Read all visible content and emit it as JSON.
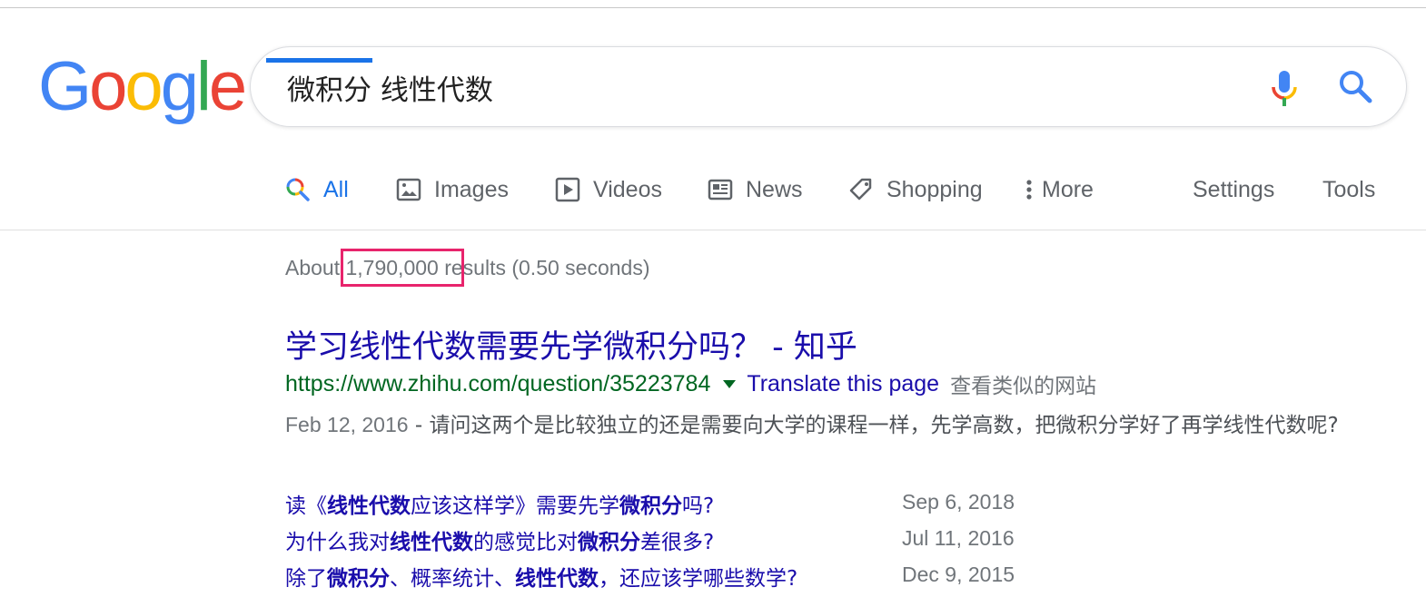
{
  "logo": {
    "letters": [
      "G",
      "o",
      "o",
      "g",
      "l",
      "e"
    ],
    "colors": [
      "#4285F4",
      "#EA4335",
      "#FBBC05",
      "#4285F4",
      "#34A853",
      "#EA4335"
    ]
  },
  "search": {
    "query": "微积分 线性代数"
  },
  "tabs": [
    {
      "label": "All",
      "icon": "search-multicolor-icon",
      "active": true
    },
    {
      "label": "Images",
      "icon": "image-icon"
    },
    {
      "label": "Videos",
      "icon": "play-icon"
    },
    {
      "label": "News",
      "icon": "newspaper-icon"
    },
    {
      "label": "Shopping",
      "icon": "tag-icon"
    },
    {
      "label": "More",
      "icon": "vertical-dots-icon"
    }
  ],
  "tools": {
    "settings": "Settings",
    "tools": "Tools"
  },
  "stats": {
    "prefix": "About ",
    "count": "1,790,000",
    "suffix": " results (0.50 seconds)"
  },
  "colors": {
    "link": "#1a0dab",
    "url": "#006621",
    "accent": "#1a73e8",
    "highlight": "#e8246c"
  },
  "result": {
    "title": "学习线性代数需要先学微积分吗？ - 知乎",
    "url": "https://www.zhihu.com/question/35223784",
    "translate": "Translate this page",
    "similar": "查看类似的网站",
    "date": "Feb 12, 2016",
    "snippet": " - 请问这两个是比较独立的还是需要向大学的课程一样，先学高数，把微积分学好了再学线性代数呢?",
    "sublinks": [
      {
        "parts": [
          {
            "t": "读《",
            "b": false
          },
          {
            "t": "线性代数",
            "b": true
          },
          {
            "t": "应该这样学》需要先学",
            "b": false
          },
          {
            "t": "微积分",
            "b": true
          },
          {
            "t": "吗?",
            "b": false
          }
        ],
        "date": "Sep 6, 2018"
      },
      {
        "parts": [
          {
            "t": "为什么我对",
            "b": false
          },
          {
            "t": "线性代数",
            "b": true
          },
          {
            "t": "的感觉比对",
            "b": false
          },
          {
            "t": "微积分",
            "b": true
          },
          {
            "t": "差很多?",
            "b": false
          }
        ],
        "date": "Jul 11, 2016"
      },
      {
        "parts": [
          {
            "t": "除了",
            "b": false
          },
          {
            "t": "微积分",
            "b": true
          },
          {
            "t": "、概率统计、",
            "b": false
          },
          {
            "t": "线性代数",
            "b": true
          },
          {
            "t": "，还应该学哪些数学?",
            "b": false
          }
        ],
        "date": "Dec 9, 2015"
      }
    ]
  }
}
